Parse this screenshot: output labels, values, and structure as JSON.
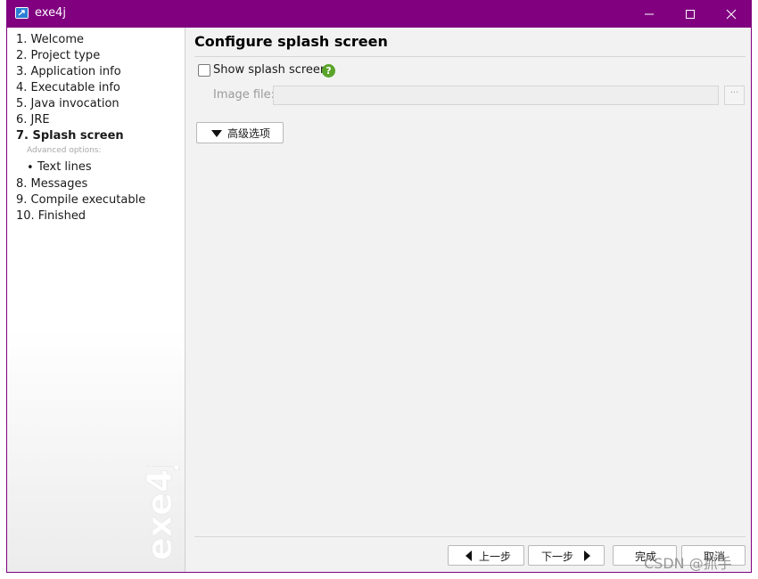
{
  "window": {
    "title": "exe4j",
    "frame_color": "#800080"
  },
  "sidebar": {
    "steps": [
      {
        "label": "1. Welcome"
      },
      {
        "label": "2. Project type"
      },
      {
        "label": "3. Application info"
      },
      {
        "label": "4. Executable info"
      },
      {
        "label": "5. Java invocation"
      },
      {
        "label": "6. JRE"
      },
      {
        "label": "7. Splash screen",
        "active": true
      },
      {
        "label": "8. Messages"
      },
      {
        "label": "9. Compile executable"
      },
      {
        "label": "10. Finished"
      }
    ],
    "advanced_label": "Advanced options:",
    "sub_step": "Text lines",
    "watermark": "exe4j"
  },
  "main": {
    "title": "Configure splash screen",
    "show_splash_label": "Show splash screen",
    "show_splash_checked": false,
    "help_glyph": "?",
    "image_file_label": "Image file:",
    "image_file_value": "",
    "browse_label": "···",
    "advanced_button": "高级选项"
  },
  "footer": {
    "back": "上一步",
    "next": "下一步",
    "finish": "完成",
    "cancel": "取消"
  },
  "watermark_overlay": "CSDN @抓手",
  "colors": {
    "help_green": "#5aa42a",
    "panel_bg": "#f2f2f2"
  }
}
